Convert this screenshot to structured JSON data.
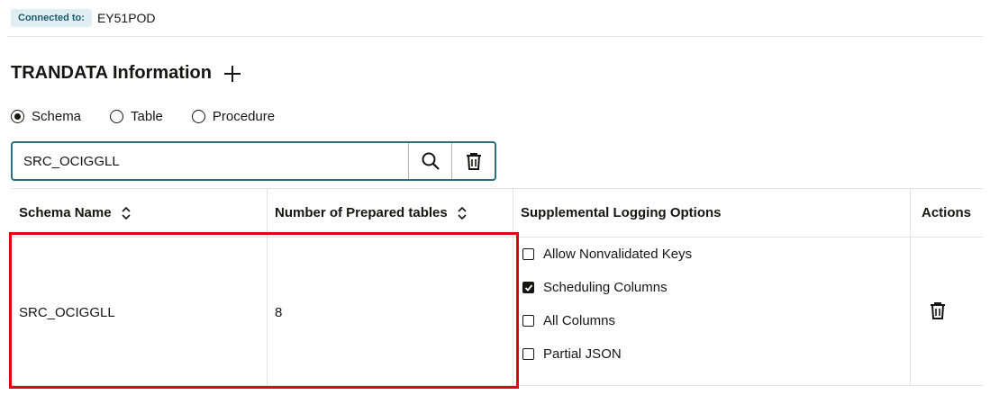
{
  "connection": {
    "label": "Connected to:",
    "value": "EY51POD"
  },
  "page": {
    "title": "TRANDATA Information"
  },
  "radios": [
    {
      "label": "Schema",
      "selected": true
    },
    {
      "label": "Table",
      "selected": false
    },
    {
      "label": "Procedure",
      "selected": false
    }
  ],
  "search": {
    "value": "SRC_OCIGGLL"
  },
  "table": {
    "columns": [
      "Schema Name",
      "Number of Prepared tables",
      "Supplemental Logging Options",
      "Actions"
    ],
    "rows": [
      {
        "schema": "SRC_OCIGGLL",
        "prepared": "8"
      }
    ]
  },
  "options": [
    {
      "label": "Allow Nonvalidated Keys",
      "checked": false
    },
    {
      "label": "Scheduling Columns",
      "checked": true
    },
    {
      "label": "All Columns",
      "checked": false
    },
    {
      "label": "Partial JSON",
      "checked": false
    }
  ],
  "colors": {
    "accent": "#2d6d80",
    "badge_bg": "#dfeef2",
    "highlight": "#e8000c"
  },
  "icons": [
    "plus-icon",
    "search-icon",
    "trash-icon",
    "sort-icon"
  ]
}
